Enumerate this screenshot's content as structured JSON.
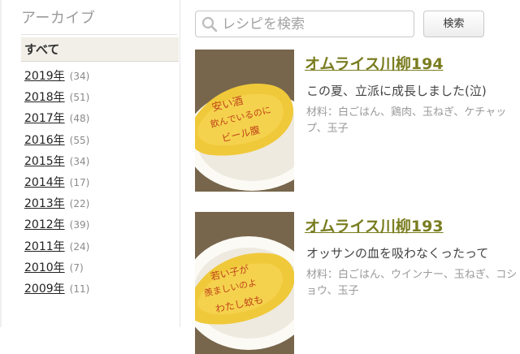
{
  "sidebar": {
    "title": "アーカイブ",
    "all_label": "すべて",
    "years": [
      {
        "label": "2019年",
        "count": "(34)"
      },
      {
        "label": "2018年",
        "count": "(51)"
      },
      {
        "label": "2017年",
        "count": "(48)"
      },
      {
        "label": "2016年",
        "count": "(55)"
      },
      {
        "label": "2015年",
        "count": "(34)"
      },
      {
        "label": "2014年",
        "count": "(17)"
      },
      {
        "label": "2013年",
        "count": "(22)"
      },
      {
        "label": "2012年",
        "count": "(39)"
      },
      {
        "label": "2011年",
        "count": "(24)"
      },
      {
        "label": "2010年",
        "count": "(7)"
      },
      {
        "label": "2009年",
        "count": "(11)"
      }
    ]
  },
  "search": {
    "placeholder": "レシピを検索",
    "button_label": "検索"
  },
  "recipes": [
    {
      "title": "オムライス川柳194",
      "description": "この夏、立派に成長しました(泣)",
      "ingredients": "材料：白ごはん、鶏肉、玉ねぎ、ケチャップ、玉子",
      "photo_text": [
        "安い酒",
        "飲んでいるのに",
        "ビール腹"
      ]
    },
    {
      "title": "オムライス川柳193",
      "description": "オッサンの血を吸わなくったって",
      "ingredients": "材料：白ごはん、ウインナー、玉ねぎ、コショウ、玉子",
      "photo_text": [
        "若い子が",
        "羨ましいのよ",
        "わたし蚊も"
      ]
    }
  ],
  "colors": {
    "title_link": "#7a7d20",
    "omelette": "#f0c93a",
    "ketchup": "#c0461a"
  }
}
